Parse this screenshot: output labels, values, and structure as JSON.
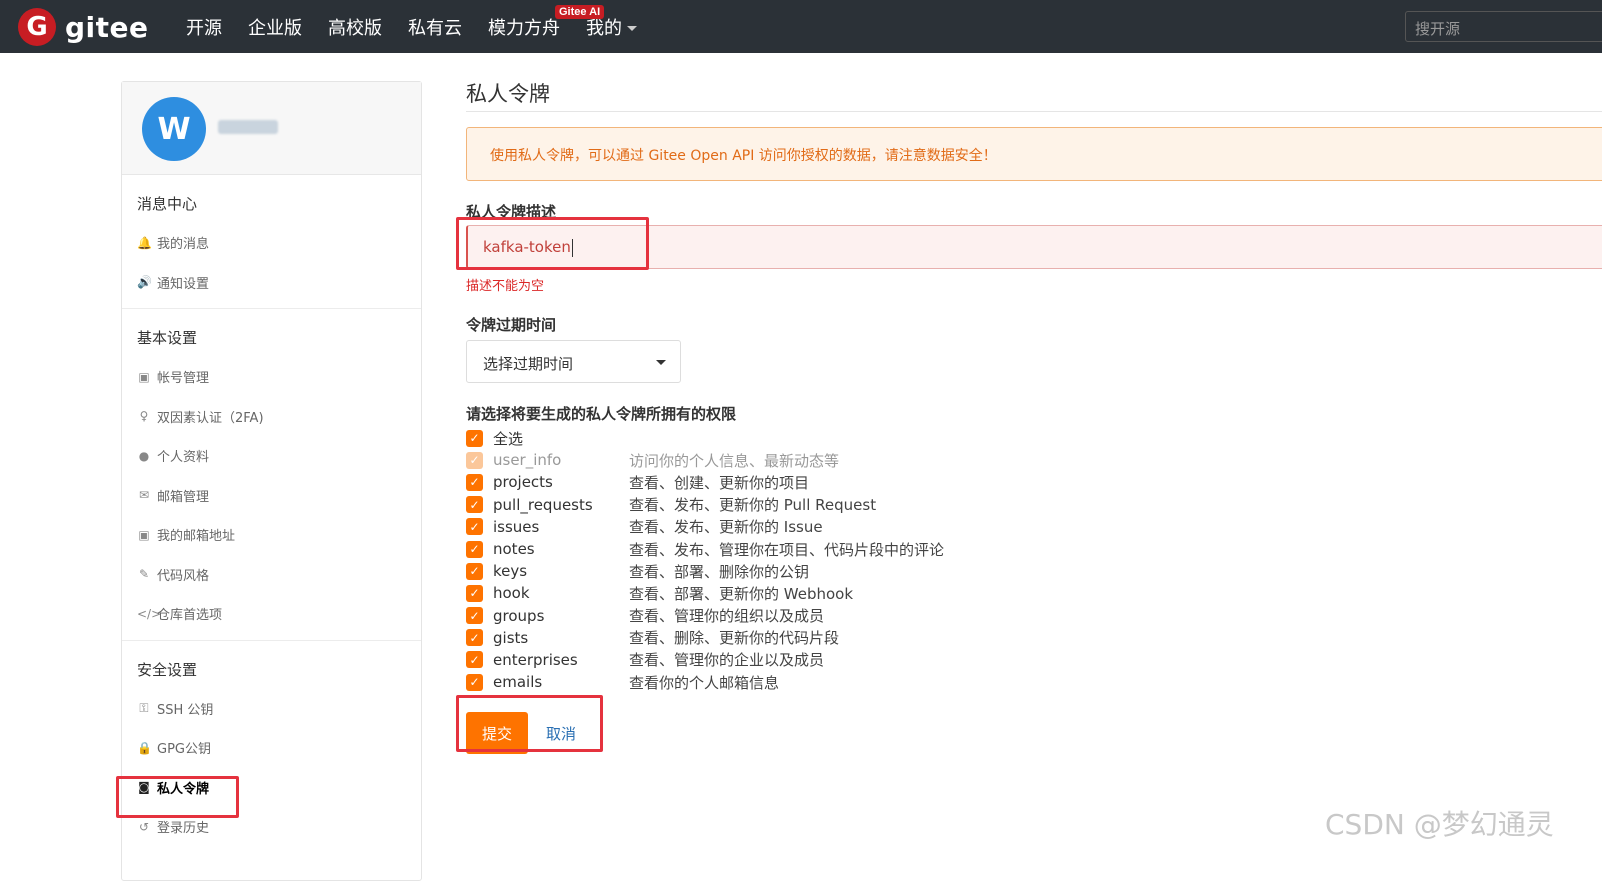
{
  "navbar": {
    "logo_letter": "G",
    "logo_text": "gitee",
    "links": [
      "开源",
      "企业版",
      "高校版",
      "私有云",
      "模力方舟",
      "我的"
    ],
    "ai_badge": "Gitee AI",
    "search_placeholder": "搜开源"
  },
  "sidebar": {
    "avatar_letter": "W",
    "sections": [
      {
        "title": "消息中心",
        "items": [
          {
            "icon": "bell-icon",
            "glyph": "🔔",
            "label": "我的消息"
          },
          {
            "icon": "speaker-icon",
            "glyph": "🔊",
            "label": "通知设置"
          }
        ]
      },
      {
        "title": "基本设置",
        "items": [
          {
            "icon": "id-card-icon",
            "glyph": "▣",
            "label": "帐号管理"
          },
          {
            "icon": "user-key-icon",
            "glyph": "♀",
            "label": "双因素认证（2FA)"
          },
          {
            "icon": "user-icon",
            "glyph": "●",
            "label": "个人资料"
          },
          {
            "icon": "envelope-icon",
            "glyph": "✉",
            "label": "邮箱管理"
          },
          {
            "icon": "address-card-icon",
            "glyph": "▣",
            "label": "我的邮箱地址"
          },
          {
            "icon": "brush-icon",
            "glyph": "✎",
            "label": "代码风格"
          },
          {
            "icon": "code-icon",
            "glyph": "</>",
            "label": "仓库首选项"
          }
        ]
      },
      {
        "title": "安全设置",
        "items": [
          {
            "icon": "key-icon",
            "glyph": "⚿",
            "label": "SSH 公钥"
          },
          {
            "icon": "lock-icon",
            "glyph": "🔒",
            "label": "GPG公钥"
          },
          {
            "icon": "user-secret-icon",
            "glyph": "◙",
            "label": "私人令牌"
          },
          {
            "icon": "history-icon",
            "glyph": "↺",
            "label": "登录历史"
          }
        ]
      }
    ]
  },
  "main": {
    "title": "私人令牌",
    "alert": "使用私人令牌，可以通过 Gitee Open API 访问你授权的数据，请注意数据安全！",
    "desc_label": "私人令牌描述",
    "desc_value": "kafka-token",
    "desc_error": "描述不能为空",
    "expire_label": "令牌过期时间",
    "expire_placeholder": "选择过期时间",
    "perm_label": "请选择将要生成的私人令牌所拥有的权限",
    "permissions": [
      {
        "name": "全选",
        "desc": "",
        "dim": false
      },
      {
        "name": "user_info",
        "desc": "访问你的个人信息、最新动态等",
        "dim": true
      },
      {
        "name": "projects",
        "desc": "查看、创建、更新你的项目",
        "dim": false
      },
      {
        "name": "pull_requests",
        "desc": "查看、发布、更新你的 Pull Request",
        "dim": false
      },
      {
        "name": "issues",
        "desc": "查看、发布、更新你的 Issue",
        "dim": false
      },
      {
        "name": "notes",
        "desc": "查看、发布、管理你在项目、代码片段中的评论",
        "dim": false
      },
      {
        "name": "keys",
        "desc": "查看、部署、删除你的公钥",
        "dim": false
      },
      {
        "name": "hook",
        "desc": "查看、部署、更新你的 Webhook",
        "dim": false
      },
      {
        "name": "groups",
        "desc": "查看、管理你的组织以及成员",
        "dim": false
      },
      {
        "name": "gists",
        "desc": "查看、删除、更新你的代码片段",
        "dim": false
      },
      {
        "name": "enterprises",
        "desc": "查看、管理你的企业以及成员",
        "dim": false
      },
      {
        "name": "emails",
        "desc": "查看你的个人邮箱信息",
        "dim": false
      }
    ],
    "submit_label": "提交",
    "cancel_label": "取消"
  },
  "watermark": "CSDN @梦幻通灵",
  "colors": {
    "navbar": "#2b3137",
    "brand": "#c71d23",
    "accent": "#fe7300",
    "annotation": "#e5323e"
  }
}
